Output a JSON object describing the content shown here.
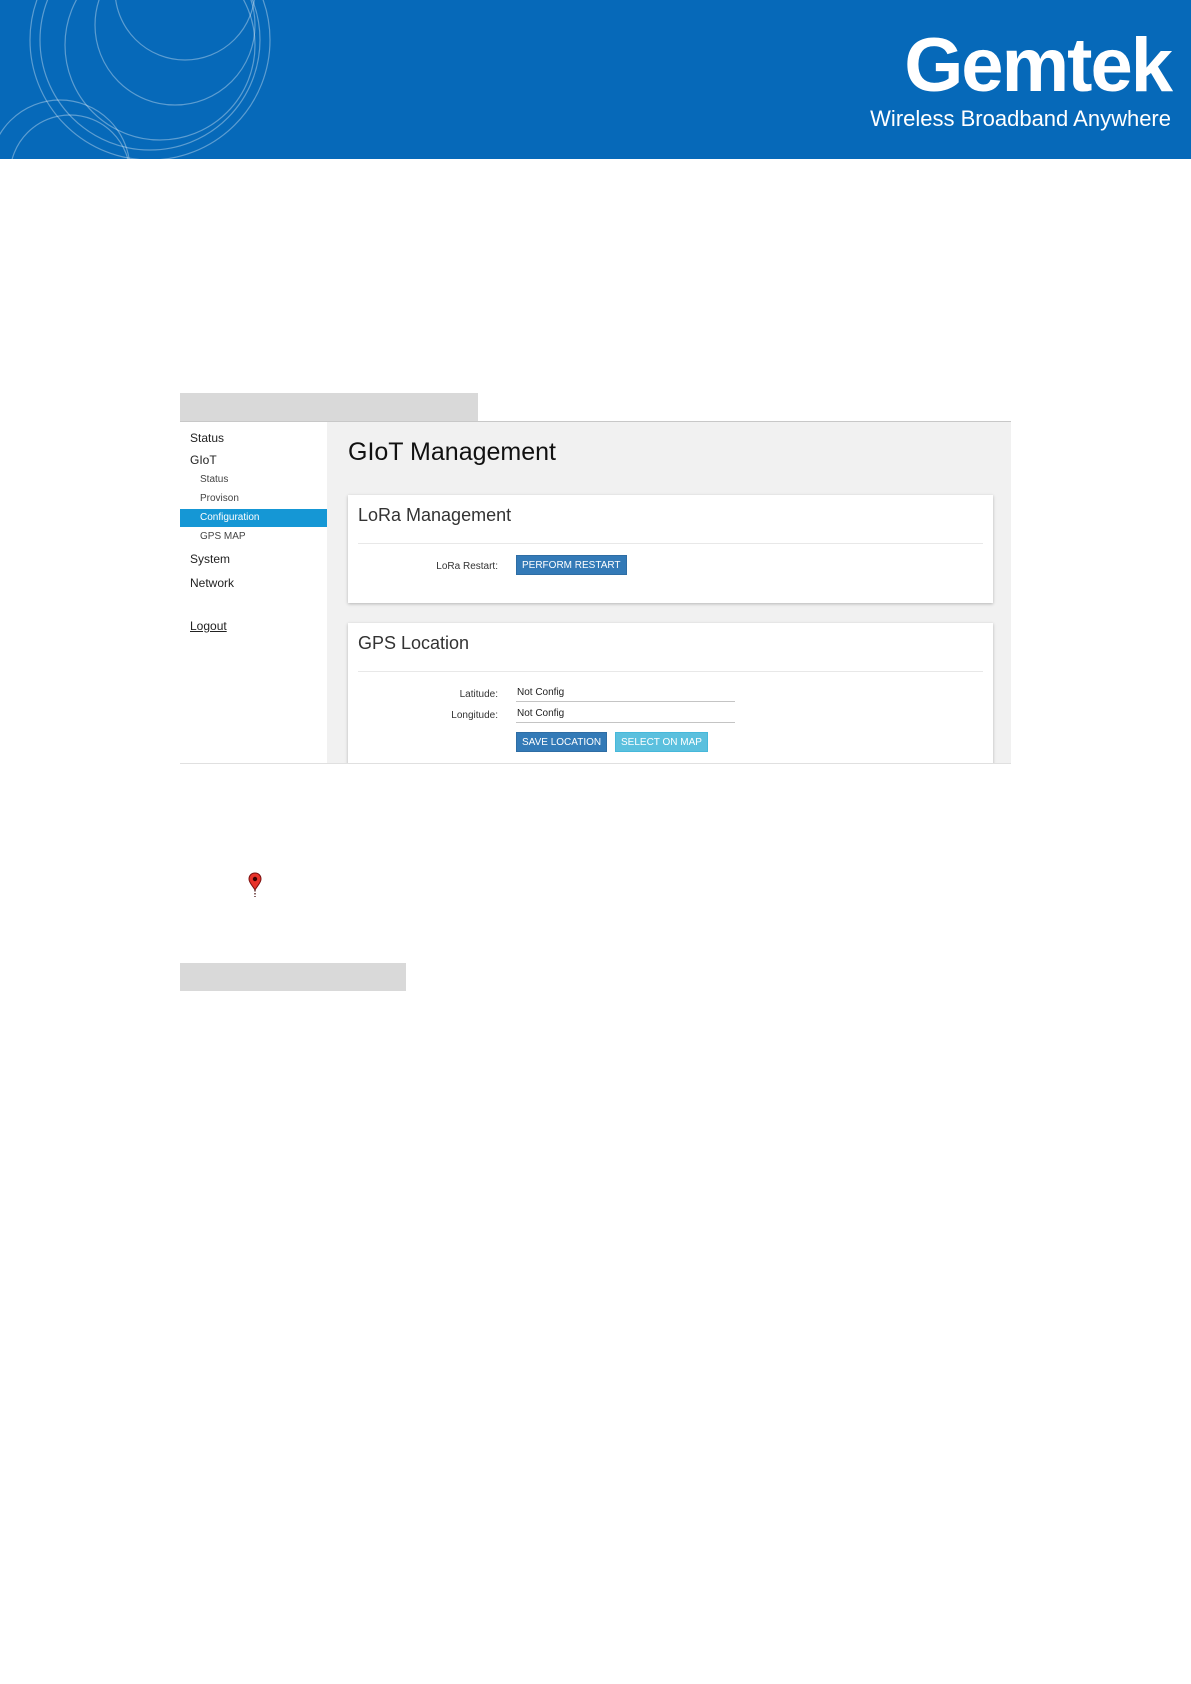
{
  "banner": {
    "brand_name": "Gemtek",
    "tagline": "Wireless Broadband Anywhere",
    "background_color": "#0669b9"
  },
  "sidebar": {
    "items": [
      {
        "label": "Status"
      },
      {
        "label": "GIoT"
      },
      {
        "label": "Status"
      },
      {
        "label": "Provison"
      },
      {
        "label": "Configuration",
        "active": true
      },
      {
        "label": "GPS MAP"
      },
      {
        "label": "System"
      },
      {
        "label": "Network"
      },
      {
        "label": "Logout"
      }
    ],
    "active_color": "#1597d5"
  },
  "main": {
    "title": "GIoT Management",
    "lora": {
      "title": "LoRa Management",
      "restart_label": "LoRa Restart:",
      "restart_button": "PERFORM RESTART"
    },
    "gps": {
      "title": "GPS Location",
      "latitude_label": "Latitude:",
      "latitude_value": "Not Config",
      "longitude_label": "Longitude:",
      "longitude_value": "Not Config",
      "save_button": "SAVE LOCATION",
      "map_button": "SELECT ON MAP"
    }
  },
  "icons": {
    "map_pin": "map-pin-icon"
  }
}
